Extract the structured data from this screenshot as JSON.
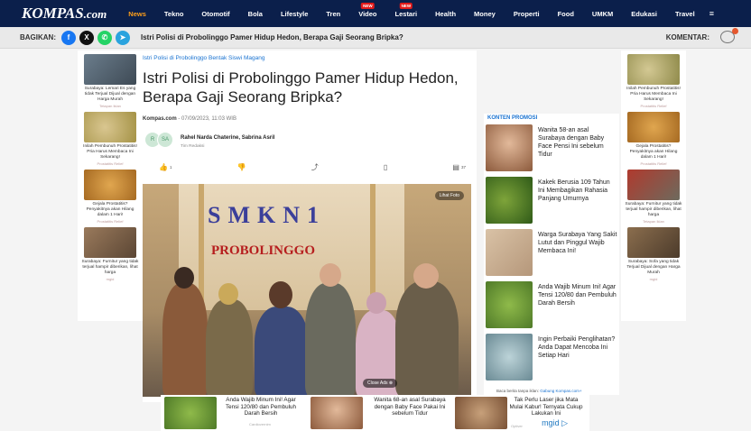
{
  "logo": {
    "main": "KOMPAS",
    "suffix": ".com"
  },
  "nav": {
    "items": [
      "News",
      "Tekno",
      "Otomotif",
      "Bola",
      "Lifestyle",
      "Tren",
      "Video",
      "Lestari",
      "Health",
      "Money",
      "Properti",
      "Food",
      "UMKM",
      "Edukasi",
      "Travel"
    ],
    "new_badge": "NEW",
    "menu_icon": "≡"
  },
  "sharebar": {
    "label": "BAGIKAN:",
    "title": "Istri Polisi di Probolinggo Pamer Hidup Hedon, Berapa Gaji Seorang Bripka?",
    "komentar": "KOMENTAR:",
    "icons": {
      "facebook": "f",
      "x": "X",
      "whatsapp": "✆",
      "telegram": "➤"
    }
  },
  "article": {
    "breadcrumb": "Istri Polisi di Probolinggo Bentak Siswi Magang",
    "headline": "Istri Polisi di Probolinggo Pamer Hidup Hedon, Berapa Gaji Seorang Bripka?",
    "source": "Kompas.com",
    "date": " - 07/09/2023, 11:03 WIB",
    "authors": "Rahel Narda Chaterine, Sabrina Asril",
    "role": "Tim Redaksi",
    "avatar1": "R",
    "avatar2": "SA",
    "likes": "1",
    "comments_count": "37",
    "photo": {
      "sign1": "SMKN1",
      "sign2": "PROBOLINGGO",
      "view_label": "Lihat Foto",
      "close_ads": "Close Ads ⊗"
    }
  },
  "left_rail": [
    {
      "caption": "Surabaya: Lemari Es yang tidak Terjual Dijual dengan Harga Murah",
      "source": "Tetapan Iklan"
    },
    {
      "caption": "Inilah Pembunuh Prostatitis! Pria Harus Membaca Ini Sekarang!",
      "source": "Prostatitis Relief"
    },
    {
      "caption": "Gejala Prostatitis? Penyakitnya akan Hilang dalam 1 Hari!",
      "source": "Prostatitis Relief"
    },
    {
      "caption": "Surabaya: Furnitur yang tidak terjual hampir diberikan, lihat harga",
      "source": "mgid"
    }
  ],
  "right_rail": [
    {
      "caption": "Inilah Pembunuh Prostatitis! Pria Harus Membaca Ini Sekarang!",
      "source": "Prostatitis Relief"
    },
    {
      "caption": "Gejala Prostatitis? Penyakitnya akan Hilang dalam 1 Hari!",
      "source": "Prostatitis Relief"
    },
    {
      "caption": "Surabaya: Furnitur yang tidak terjual hampir diberikan, lihat harga",
      "source": "Tetapan Iklan"
    },
    {
      "caption": "Surabaya: Sofa yang tidak Terjual Dijual dengan Harga Murah",
      "source": "mgid"
    }
  ],
  "promo": {
    "title": "KONTEN PROMOSI",
    "items": [
      "Wanita 58-an asal Surabaya dengan Baby Face Pensi Ini sebelum Tidur",
      "Kakek Berusia 109 Tahun Ini Membagikan Rahasia Panjang Umurnya",
      "Warga Surabaya Yang Sakit Lutut dan Pinggul Wajib Membaca Ini!",
      "Anda Wajib Minum Ini! Agar Tensi 120/80 dan Pembuluh Darah Bersih",
      "Ingin Perbaiki Penglihatan? Anda Dapat Mencoba Ini Setiap Hari"
    ],
    "foot_prefix": "Baca berita tanpa iklan:",
    "foot_link": "Gabung Kompas.com+"
  },
  "bottom_ad": {
    "items": [
      {
        "text": "Anda Wajib Minum Ini! Agar Tensi 120/80 dan Pembuluh Darah Bersih",
        "source": "Cardiovernim"
      },
      {
        "text": "Wanita 68-an asal Surabaya dengan Baby Face Pakai Ini sebelum Tidur",
        "source": ""
      },
      {
        "text": "Tak Perlu Laser jika Mata Mulai Kabur! Ternyata Cukup Lakukan Ini",
        "source": "Optiver"
      }
    ],
    "brand": "mgid ▷"
  },
  "colors": {
    "nav_bg": "#0b1f4b",
    "accent": "#ff9f1a",
    "link": "#1a73d1",
    "new_badge": "#e21b1b"
  }
}
